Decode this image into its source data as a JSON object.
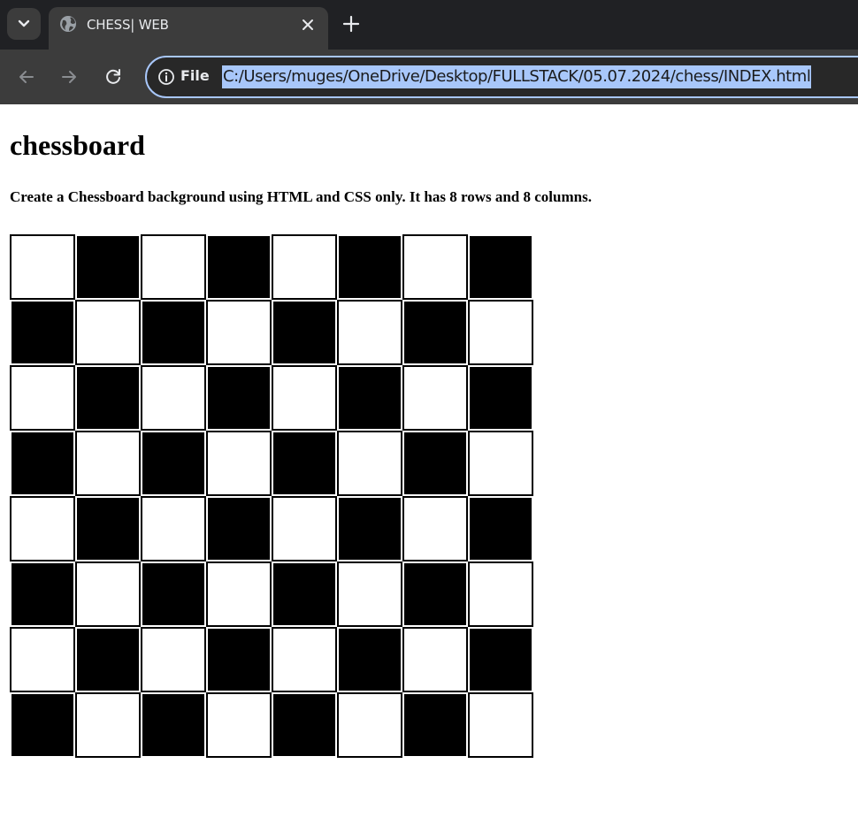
{
  "browser": {
    "tab_title": "CHESS| WEB",
    "omnibox": {
      "scheme_label": "File",
      "url": "C:/Users/muges/OneDrive/Desktop/FULLSTACK/05.07.2024/chess/INDEX.html"
    },
    "icons": [
      "chevron-down-icon",
      "globe-icon",
      "close-icon",
      "plus-icon",
      "back-arrow-icon",
      "forward-arrow-icon",
      "reload-icon",
      "info-icon"
    ]
  },
  "page": {
    "heading": "chessboard",
    "description": "Create a Chessboard background using HTML and CSS only. It has 8 rows and 8 columns."
  },
  "board": {
    "rows": 8,
    "columns": 8,
    "first_square": "white",
    "colors": {
      "light": "#ffffff",
      "dark": "#000000"
    }
  }
}
